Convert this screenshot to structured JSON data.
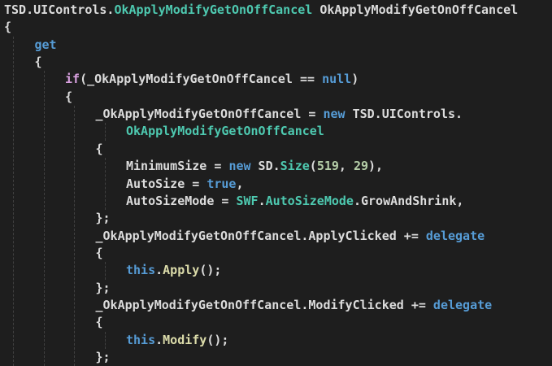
{
  "editor": {
    "background": "#1e1e1e",
    "token_colors": {
      "plain": "#dcdcdc",
      "type": "#4ec9b0",
      "keyword": "#569cd6",
      "control": "#d8a0df",
      "number": "#b5cea8",
      "method": "#dcdcaa"
    },
    "lines": [
      {
        "indent": 0,
        "tokens": [
          {
            "c": "plain",
            "t": "TSD.UIControls."
          },
          {
            "c": "type",
            "t": "OkApplyModifyGetOnOffCancel"
          },
          {
            "c": "plain",
            "t": " OkApplyModifyGetOnOffCancel"
          }
        ]
      },
      {
        "indent": 0,
        "tokens": [
          {
            "c": "plain",
            "t": "{"
          }
        ]
      },
      {
        "indent": 1,
        "tokens": [
          {
            "c": "kw",
            "t": "get"
          }
        ]
      },
      {
        "indent": 1,
        "tokens": [
          {
            "c": "plain",
            "t": "{"
          }
        ]
      },
      {
        "indent": 2,
        "tokens": [
          {
            "c": "ctl",
            "t": "if"
          },
          {
            "c": "plain",
            "t": "(_OkApplyModifyGetOnOffCancel == "
          },
          {
            "c": "kw",
            "t": "null"
          },
          {
            "c": "plain",
            "t": ")"
          }
        ]
      },
      {
        "indent": 2,
        "tokens": [
          {
            "c": "plain",
            "t": "{"
          }
        ]
      },
      {
        "indent": 3,
        "tokens": [
          {
            "c": "plain",
            "t": "_OkApplyModifyGetOnOffCancel = "
          },
          {
            "c": "kw",
            "t": "new"
          },
          {
            "c": "plain",
            "t": " TSD.UIControls."
          }
        ]
      },
      {
        "indent": 4,
        "tokens": [
          {
            "c": "type",
            "t": "OkApplyModifyGetOnOffCancel"
          }
        ]
      },
      {
        "indent": 3,
        "tokens": [
          {
            "c": "plain",
            "t": "{"
          }
        ]
      },
      {
        "indent": 4,
        "tokens": [
          {
            "c": "plain",
            "t": "MinimumSize = "
          },
          {
            "c": "kw",
            "t": "new"
          },
          {
            "c": "plain",
            "t": " SD."
          },
          {
            "c": "type",
            "t": "Size"
          },
          {
            "c": "plain",
            "t": "("
          },
          {
            "c": "num",
            "t": "519"
          },
          {
            "c": "plain",
            "t": ", "
          },
          {
            "c": "num",
            "t": "29"
          },
          {
            "c": "plain",
            "t": "),"
          }
        ]
      },
      {
        "indent": 4,
        "tokens": [
          {
            "c": "plain",
            "t": "AutoSize = "
          },
          {
            "c": "kw",
            "t": "true"
          },
          {
            "c": "plain",
            "t": ","
          }
        ]
      },
      {
        "indent": 4,
        "tokens": [
          {
            "c": "plain",
            "t": "AutoSizeMode = "
          },
          {
            "c": "type",
            "t": "SWF"
          },
          {
            "c": "plain",
            "t": "."
          },
          {
            "c": "type",
            "t": "AutoSizeMode"
          },
          {
            "c": "plain",
            "t": ".GrowAndShrink,"
          }
        ]
      },
      {
        "indent": 3,
        "tokens": [
          {
            "c": "plain",
            "t": "};"
          }
        ]
      },
      {
        "indent": 3,
        "tokens": [
          {
            "c": "plain",
            "t": "_OkApplyModifyGetOnOffCancel.ApplyClicked += "
          },
          {
            "c": "kw",
            "t": "delegate"
          }
        ]
      },
      {
        "indent": 3,
        "tokens": [
          {
            "c": "plain",
            "t": "{"
          }
        ]
      },
      {
        "indent": 4,
        "tokens": [
          {
            "c": "kw",
            "t": "this"
          },
          {
            "c": "plain",
            "t": "."
          },
          {
            "c": "method",
            "t": "Apply"
          },
          {
            "c": "plain",
            "t": "();"
          }
        ]
      },
      {
        "indent": 3,
        "tokens": [
          {
            "c": "plain",
            "t": "};"
          }
        ]
      },
      {
        "indent": 3,
        "tokens": [
          {
            "c": "plain",
            "t": "_OkApplyModifyGetOnOffCancel.ModifyClicked += "
          },
          {
            "c": "kw",
            "t": "delegate"
          }
        ]
      },
      {
        "indent": 3,
        "tokens": [
          {
            "c": "plain",
            "t": "{"
          }
        ]
      },
      {
        "indent": 4,
        "tokens": [
          {
            "c": "kw",
            "t": "this"
          },
          {
            "c": "plain",
            "t": "."
          },
          {
            "c": "method",
            "t": "Modify"
          },
          {
            "c": "plain",
            "t": "();"
          }
        ]
      },
      {
        "indent": 3,
        "tokens": [
          {
            "c": "plain",
            "t": "};"
          }
        ]
      }
    ],
    "guides": [
      {
        "level": 0,
        "from_line": 2,
        "to_line": 20
      },
      {
        "level": 1,
        "from_line": 4,
        "to_line": 20
      },
      {
        "level": 2,
        "from_line": 6,
        "to_line": 20
      },
      {
        "level": 3,
        "from_line": 7,
        "to_line": 7
      },
      {
        "level": 3,
        "from_line": 9,
        "to_line": 11
      },
      {
        "level": 3,
        "from_line": 15,
        "to_line": 15
      },
      {
        "level": 3,
        "from_line": 19,
        "to_line": 19
      }
    ]
  }
}
